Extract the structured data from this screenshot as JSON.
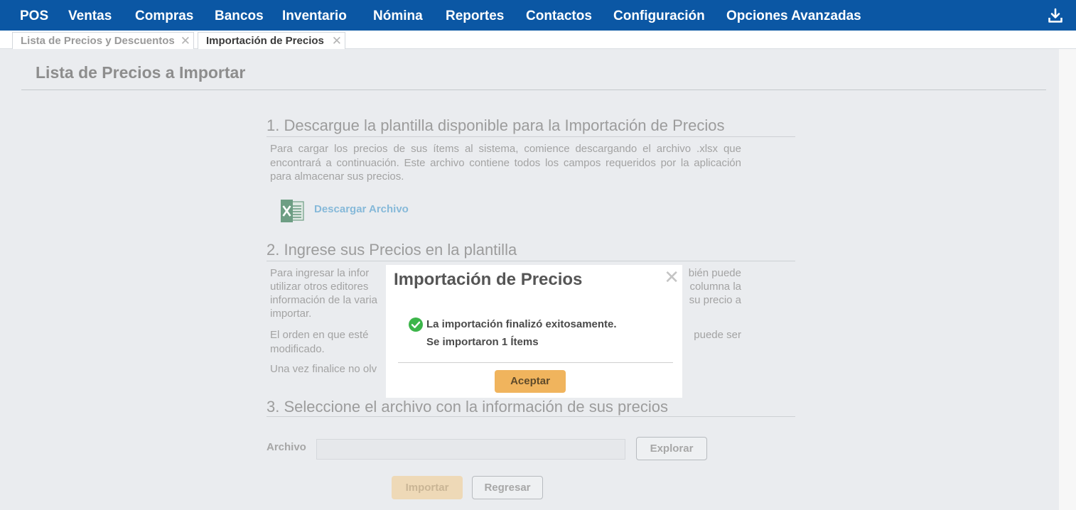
{
  "nav": {
    "items": [
      {
        "label": "POS"
      },
      {
        "label": "Ventas"
      },
      {
        "label": "Compras"
      },
      {
        "label": "Bancos"
      },
      {
        "label": "Inventario"
      },
      {
        "label": "Nómina"
      },
      {
        "label": "Reportes"
      },
      {
        "label": "Contactos"
      },
      {
        "label": "Configuración"
      },
      {
        "label": "Opciones Avanzadas"
      }
    ],
    "download_icon": "download-icon",
    "background": "#0b57a4"
  },
  "tabs": [
    {
      "label": "Lista de Precios y Descuentos",
      "close": "✕",
      "active": false
    },
    {
      "label": "Importación de Precios",
      "close": "✕",
      "active": true
    }
  ],
  "page": {
    "title": "Lista de Precios a Importar",
    "step1": {
      "heading": "1. Descargue la plantilla disponible para la Importación de Precios",
      "text": "Para cargar los precios de sus ítems al sistema, comience descargando el archivo .xlsx que encontrará a continuación. Este archivo contiene todos los campos requeridos por la aplicación para almacenar sus precios.",
      "download_label": "Descargar Archivo",
      "file_icon": "excel-icon"
    },
    "step2": {
      "heading": "2. Ingrese sus Precios en la plantilla",
      "text1_left": "Para ingresar la infor",
      "text1_right": "bién puede",
      "text2_left": "utilizar otros editores",
      "text2_right": "columna la",
      "text3_left": "información de la varia",
      "text3_right": "su precio a",
      "text4": "importar.",
      "text5_left": "El orden en que esté",
      "text5_right": "puede ser",
      "text6": "modificado.",
      "text7": "Una vez finalice no olv"
    },
    "step3": {
      "heading": "3. Seleccione el archivo con la información de sus precios",
      "file_label": "Archivo",
      "file_value": "",
      "explore_label": "Explorar"
    },
    "import_label": "Importar",
    "back_label": "Regresar"
  },
  "modal": {
    "title": "Importación de Precios",
    "close": "✕",
    "success_icon": "check-circle-icon",
    "message_line1": "La importación finalizó exitosamente.",
    "message_line2": "Se importaron 1 Ítems",
    "accept_label": "Aceptar",
    "success_color": "#3cb54a",
    "accent": "#f0b45d"
  }
}
